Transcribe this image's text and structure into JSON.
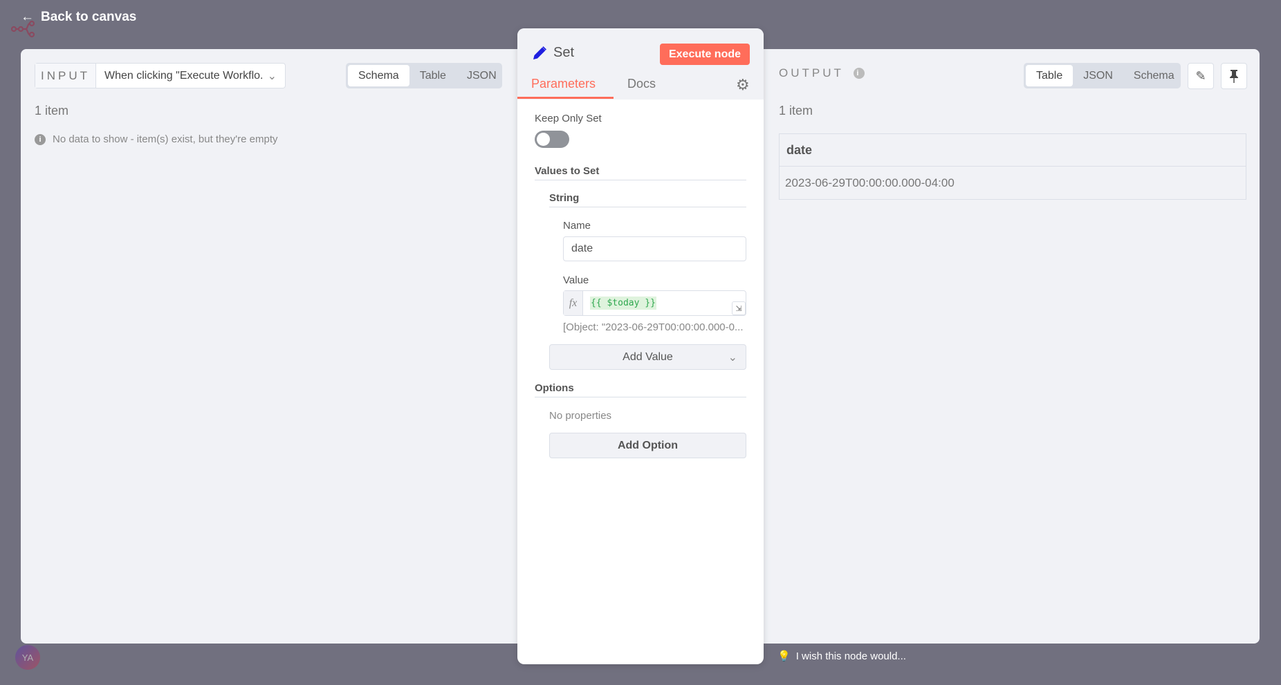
{
  "back_label": "Back to canvas",
  "input": {
    "label": "INPUT",
    "source": "When clicking \"Execute Workflo.",
    "tabs": [
      "Schema",
      "Table",
      "JSON"
    ],
    "active_tab": "Schema",
    "count": "1 item",
    "empty_message": "No data to show - item(s) exist, but they're empty"
  },
  "node": {
    "title": "Set",
    "execute_label": "Execute node",
    "tabs": [
      "Parameters",
      "Docs"
    ],
    "active_tab": "Parameters",
    "keep_only_set_label": "Keep Only Set",
    "keep_only_set": false,
    "values_to_set": "Values to Set",
    "string_section": "String",
    "name_label": "Name",
    "name_value": "date",
    "value_label": "Value",
    "fx": "fx",
    "value_expression": "{{ $today }}",
    "value_preview": "[Object: \"2023-06-29T00:00:00.000-0...",
    "add_value": "Add Value",
    "options": "Options",
    "no_properties": "No properties",
    "add_option": "Add Option"
  },
  "output": {
    "label": "OUTPUT",
    "tabs": [
      "Table",
      "JSON",
      "Schema"
    ],
    "active_tab": "Table",
    "count": "1 item",
    "columns": [
      "date"
    ],
    "rows": [
      [
        "2023-06-29T00:00:00.000-04:00"
      ]
    ]
  },
  "feedback": "I wish this node would...",
  "avatar": "YA",
  "colors": {
    "accent": "#ff6d5a",
    "overlay": "#71707f",
    "panel": "#f1f2f6"
  }
}
